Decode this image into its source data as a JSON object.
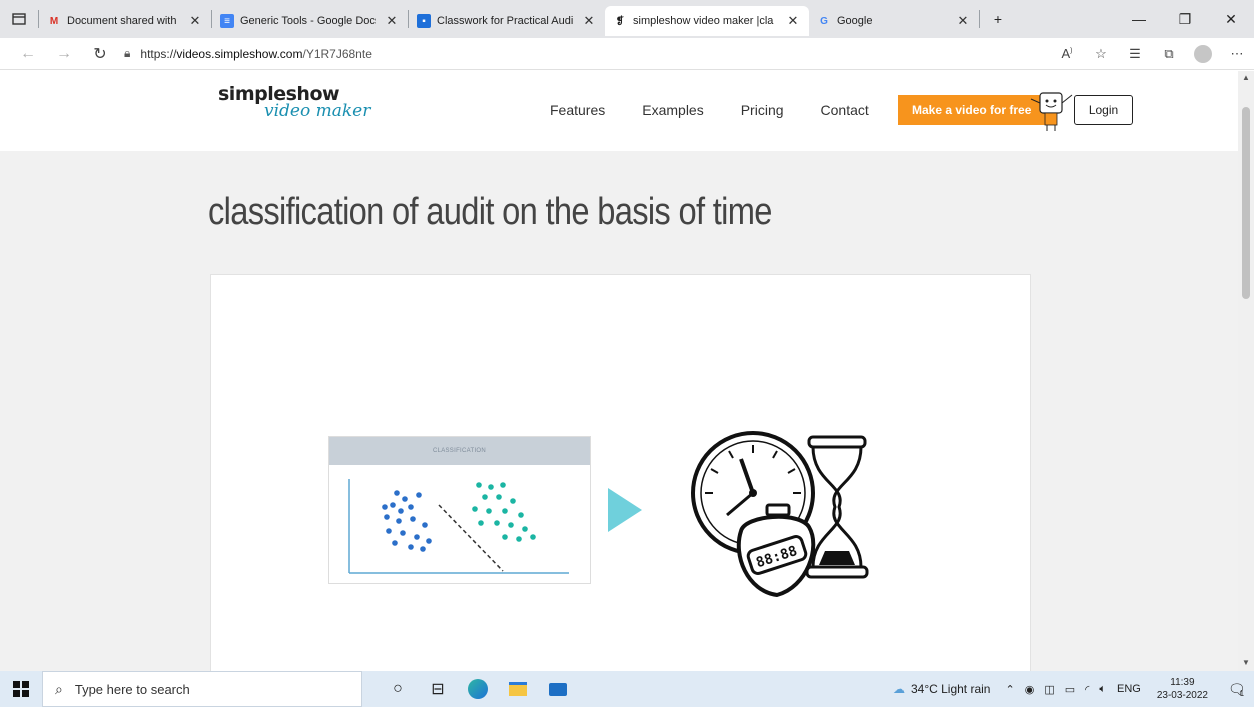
{
  "tabs": [
    {
      "label": "Document shared with you: \"",
      "icon": "gmail-icon",
      "color": "#d93025"
    },
    {
      "label": "Generic Tools - Google Docs",
      "icon": "google-docs-icon",
      "color": "#4285f4"
    },
    {
      "label": "Classwork for Practical Auditi",
      "icon": "classroom-icon",
      "color": "#1e6fd9"
    },
    {
      "label": "simpleshow video maker |cla",
      "icon": "simpleshow-icon",
      "active": true
    },
    {
      "label": "Google",
      "icon": "google-icon"
    }
  ],
  "address": {
    "url_prefix": "https://",
    "url_domain": "videos.simpleshow.com",
    "url_path": "/Y1R7J68nte"
  },
  "site": {
    "logo_line1": "simpleshow",
    "logo_line2": "video maker",
    "nav": [
      "Features",
      "Examples",
      "Pricing",
      "Contact"
    ],
    "cta": "Make a video for free",
    "login": "Login",
    "brand_color": "#f7941d",
    "accent_color": "#1a8fb0"
  },
  "content": {
    "title": "classification of audit on the basis of time",
    "chart_heading": "CLASSIFICATION",
    "play_color": "#6fd0dc",
    "clock_digits": "88:88"
  },
  "taskbar": {
    "search_placeholder": "Type here to search",
    "weather": "34°C  Light rain",
    "language": "ENG",
    "time": "11:39",
    "date": "23-03-2022",
    "notification_count": "1"
  }
}
